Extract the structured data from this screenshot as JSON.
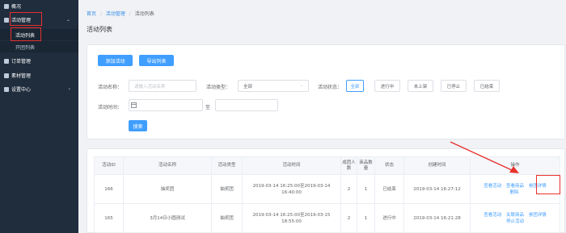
{
  "sidebar": {
    "items": [
      {
        "label": "概况"
      },
      {
        "label": "活动管理",
        "arrow": "⌄"
      },
      {
        "label": "订单管理"
      },
      {
        "label": "素材管理"
      },
      {
        "label": "设置中心",
        "arrow": "›"
      }
    ],
    "sub_items": [
      {
        "label": "活动列表"
      },
      {
        "label": "开团列表"
      }
    ]
  },
  "breadcrumb": {
    "home": "首页",
    "sep": "/",
    "section": "活动管理",
    "current": "活动列表"
  },
  "page_title": "活动列表",
  "toolbar": {
    "add_label": "添加活动",
    "export_label": "导出列表"
  },
  "filter": {
    "name_label": "活动名称：",
    "name_placeholder": "请输入活动名称",
    "type_label": "活动类型：",
    "type_value": "全部",
    "status_label": "活动状态：",
    "status_options": [
      "全部",
      "进行中",
      "未上架",
      "已停止",
      "已结束"
    ],
    "time_label": "活动时间：",
    "time_separator": "至",
    "search_label": "搜索"
  },
  "table": {
    "columns": [
      "活动ID",
      "活动名称",
      "活动类型",
      "活动时间",
      "成团人数",
      "商品数量",
      "状态",
      "创建时间",
      "操作"
    ],
    "rows": [
      {
        "id": "166",
        "name": "抽奖团",
        "type": "抽奖团",
        "time": "2019-03-14 16:25:00至2019-03-14 16:40:00",
        "people": "2",
        "goods": "1",
        "status": "已结束",
        "created": "2019-03-14 16:27:12",
        "ops": [
          "查看活动",
          "查看商品",
          "删除",
          "参团详情"
        ]
      },
      {
        "id": "165",
        "name": "3月14日小圆测试",
        "type": "抽奖团",
        "time": "2019-03-14 16:25:00至2019-03-15 18:55:00",
        "people": "2",
        "goods": "1",
        "status": "进行中",
        "created": "2019-03-14 16:21:28",
        "ops": [
          "查看活动",
          "关联商品",
          "停止活动",
          "参团详情"
        ]
      }
    ]
  },
  "colors": {
    "accent": "#409eff",
    "sidebar_bg": "#1f2d3d",
    "annotation": "#e8302e"
  },
  "icons": {
    "overview": "overview-icon",
    "activity": "activity-icon",
    "order": "order-icon",
    "material": "material-icon",
    "settings": "settings-icon",
    "calendar": "calendar-icon"
  }
}
